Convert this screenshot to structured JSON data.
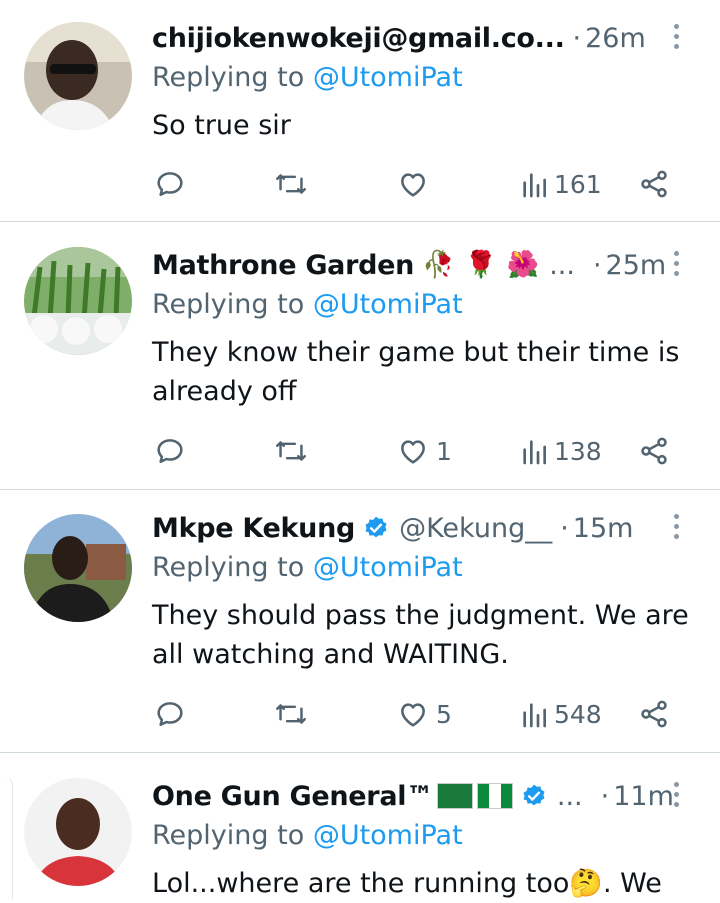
{
  "tweets": [
    {
      "name": "chijiokenwokeji@gmail.co...",
      "handle": "",
      "time": "26m",
      "replying_prefix": "Replying to ",
      "replying_to": "@UtomiPat",
      "text": "So true sir",
      "likes": "",
      "views": "161"
    },
    {
      "name": "Mathrone Garden",
      "handle": "",
      "emojis": [
        "🥀",
        "🌹",
        "🌺"
      ],
      "ellipsis": "...",
      "time": "25m",
      "replying_prefix": "Replying to ",
      "replying_to": "@UtomiPat",
      "text_line1": "They know their game but their time is",
      "text_line2": "already off",
      "likes": "1",
      "views": "138"
    },
    {
      "name": "Mkpe Kekung",
      "handle": "@Kekung__",
      "time": "15m",
      "replying_prefix": "Replying to ",
      "replying_to": "@UtomiPat",
      "text_line1": "They should pass the judgment. We are",
      "text_line2": "all watching and WAITING.",
      "likes": "5",
      "views": "548"
    },
    {
      "name": "One Gun General™",
      "ellipsis": "...",
      "time": "11m",
      "replying_prefix": "Replying to ",
      "replying_to": "@UtomiPat",
      "text_partial": "Lol...where are the running too🤔. We"
    }
  ],
  "colors": {
    "link": "#1d9bf0",
    "secondary": "#536471",
    "verified": "#1d9bf0",
    "divider": "#cfd9de"
  },
  "icons": [
    "reply-icon",
    "retweet-icon",
    "like-icon",
    "views-icon",
    "share-icon",
    "more-icon",
    "verified-badge-icon"
  ]
}
